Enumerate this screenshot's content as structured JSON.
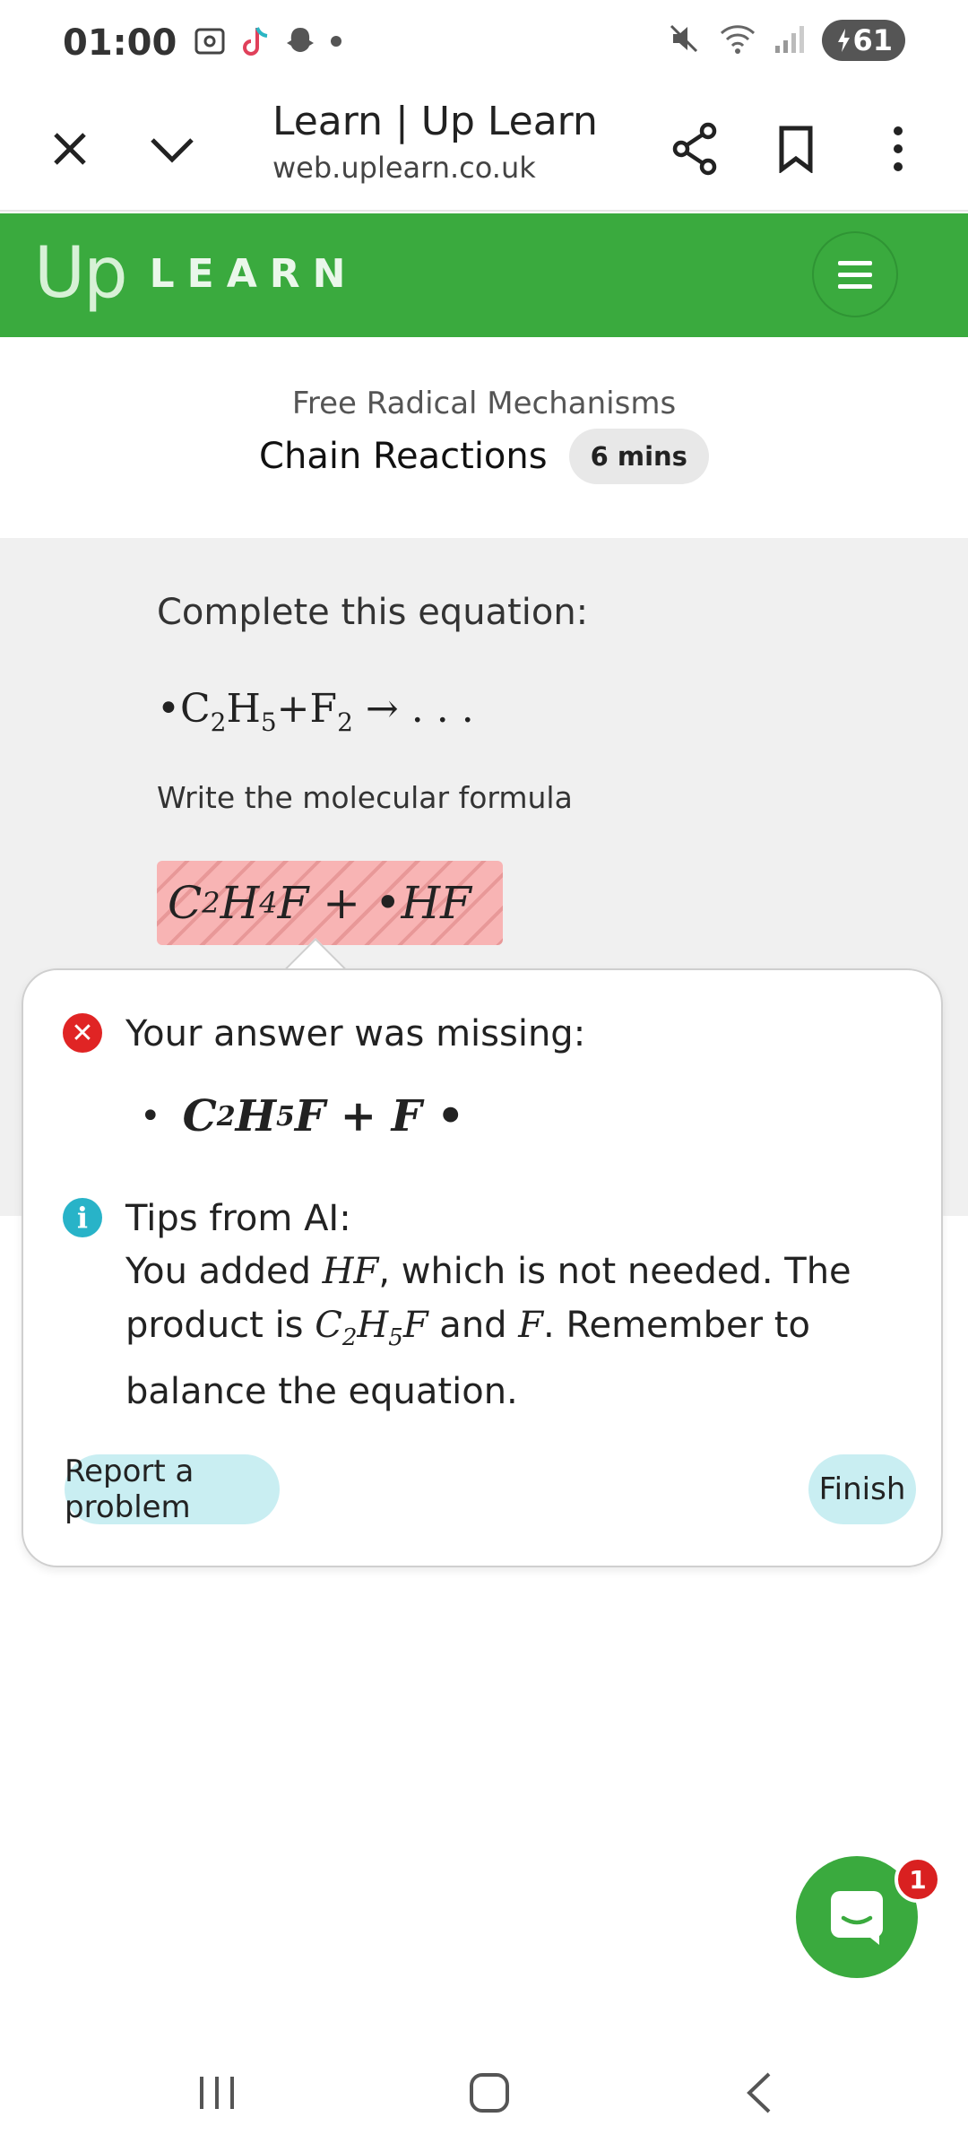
{
  "status_bar": {
    "time": "01:00",
    "battery": "61"
  },
  "browser": {
    "title": "Learn | Up Learn",
    "url": "web.uplearn.co.uk"
  },
  "header": {
    "logo_up": "Up",
    "logo_learn": "LEARN",
    "brand_color": "#3aaa3e"
  },
  "lesson": {
    "subtitle": "Free Radical Mechanisms",
    "title": "Chain Reactions",
    "duration": "6 mins"
  },
  "question": {
    "prompt": "Complete this equation:",
    "equation": {
      "radical": "•",
      "reactant1": "C",
      "r1_sub1": "2",
      "r1_h": "H",
      "r1_sub2": "5",
      "plus": "+",
      "reactant2": "F",
      "r2_sub": "2",
      "arrow": "→ . . ."
    },
    "instruction": "Write the molecular formula",
    "user_answer": {
      "c": "C",
      "c_sub": "2",
      "h": "H",
      "h_sub": "4",
      "rest": "F + •HF"
    }
  },
  "feedback": {
    "missing_label": "Your answer was missing:",
    "missing_item": {
      "bullet": "•",
      "c": "C",
      "c_sub": "2",
      "h": "H",
      "h_sub": "5",
      "rest": "F + F •"
    },
    "tips_title": "Tips from AI:",
    "tips": {
      "t1": "You added ",
      "m1": "HF",
      "t2": ", which is not needed. The product is ",
      "m2_c": "C",
      "m2_c_sub": "2",
      "m2_h": "H",
      "m2_h_sub": "5",
      "m2_f": "F",
      "t3": " and ",
      "m3": "F",
      "t4": ". Remember to balance the equation."
    },
    "report_button": "Report a problem",
    "finish_button": "Finish"
  },
  "chat": {
    "badge_count": "1"
  }
}
